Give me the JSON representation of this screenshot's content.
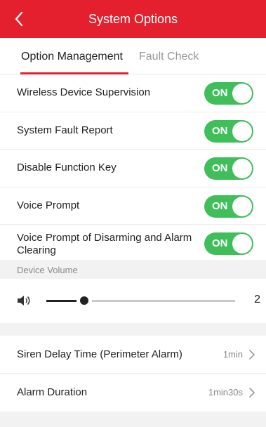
{
  "header": {
    "title": "System Options",
    "back_icon": "chevron-left-icon",
    "color": "#e4202e"
  },
  "tabs": [
    {
      "label": "Option Management",
      "active": true
    },
    {
      "label": "Fault Check",
      "active": false
    }
  ],
  "settings": [
    {
      "label": "Wireless Device Supervision",
      "state": "ON"
    },
    {
      "label": "System Fault Report",
      "state": "ON"
    },
    {
      "label": "Disable Function Key",
      "state": "ON"
    },
    {
      "label": "Voice Prompt",
      "state": "ON"
    },
    {
      "label": "Voice Prompt of Disarming and Alarm Clearing",
      "state": "ON"
    }
  ],
  "toggle_color": "#3fbe5a",
  "volume": {
    "section_label": "Device Volume",
    "icon": "speaker-icon",
    "value": "2",
    "level_fraction": 0.2
  },
  "nav_items": [
    {
      "label": "Siren Delay Time (Perimeter Alarm)",
      "value": "1min"
    },
    {
      "label": "Alarm Duration",
      "value": "1min30s"
    }
  ]
}
